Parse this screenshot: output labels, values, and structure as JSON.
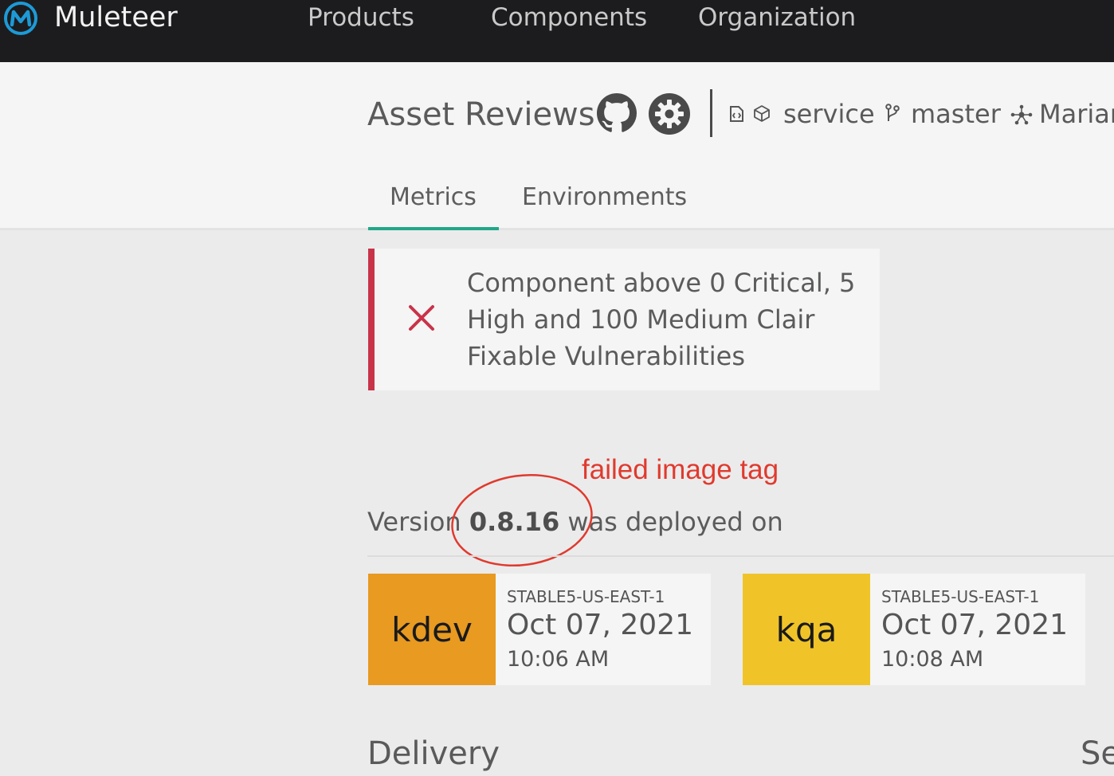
{
  "nav": {
    "brand": "Muleteer",
    "links": [
      "Products",
      "Components",
      "Organization"
    ]
  },
  "header": {
    "title": "Asset Reviews",
    "type_label": "service",
    "branch_label": "master",
    "team_label": "Mariar"
  },
  "tabs": [
    {
      "label": "Metrics",
      "active": true
    },
    {
      "label": "Environments",
      "active": false
    }
  ],
  "alert": {
    "status": "failed",
    "message": "Component above 0 Critical, 5 High and 100 Medium Clair Fixable Vulnerabilities"
  },
  "annotation": {
    "text": "failed image tag"
  },
  "version": {
    "prefix": "Version ",
    "number": "0.8.16",
    "suffix": " was deployed on"
  },
  "deployments": [
    {
      "env": "kdev",
      "region": "STABLE5-US-EAST-1",
      "date": "Oct 07, 2021",
      "time": "10:06 AM",
      "color": "#e89a21"
    },
    {
      "env": "kqa",
      "region": "STABLE5-US-EAST-1",
      "date": "Oct 07, 2021",
      "time": "10:08 AM",
      "color": "#f0c429"
    }
  ],
  "sections": {
    "delivery": "Delivery",
    "right_partial": "Se"
  },
  "colors": {
    "accent": "#20a888",
    "alert": "#c8334a",
    "annotation": "#e03a2d"
  }
}
